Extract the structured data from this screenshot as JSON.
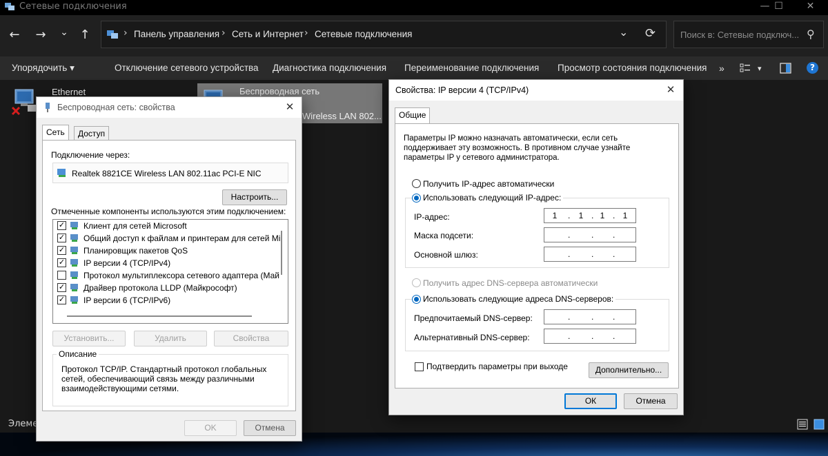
{
  "window": {
    "title": "Сетевые подключения",
    "controls": {
      "minimize": "—",
      "maximize": "☐",
      "close": "✕"
    }
  },
  "nav": {
    "back": "←",
    "forward": "→",
    "recent": "⌄",
    "up": "↑",
    "breadcrumb": [
      "Панель управления",
      "Сеть и Интернет",
      "Сетевые подключения"
    ],
    "separator": "›",
    "dropdown": "⌄",
    "refresh": "⟳",
    "search_placeholder": "Поиск в: Сетевые подключ...",
    "search_icon": "⚲"
  },
  "commands": {
    "organize": "Упорядочить",
    "items": [
      "Отключение сетевого устройства",
      "Диагностика подключения",
      "Переименование подключения",
      "Просмотр состояния подключения"
    ],
    "more": "»",
    "help": "?"
  },
  "connections": [
    {
      "name": "Ethernet",
      "status_icon": "red-x-icon"
    },
    {
      "name": "Беспроводная сеть",
      "device": "Wireless LAN 802..."
    }
  ],
  "status": {
    "items_label": "Элеме"
  },
  "wifi_props": {
    "title": "Беспроводная сеть: свойства",
    "close": "✕",
    "tabs": [
      "Сеть",
      "Доступ"
    ],
    "connect_via_label": "Подключение через:",
    "adapter": "Realtek 8821CE Wireless LAN 802.11ac PCI-E NIC",
    "configure": "Настроить...",
    "components_label": "Отмеченные компоненты используются этим подключением:",
    "components": [
      {
        "name": "Клиент для сетей Microsoft",
        "checked": true
      },
      {
        "name": "Общий доступ к файлам и принтерам для сетей Mi",
        "checked": true
      },
      {
        "name": "Планировщик пакетов QoS",
        "checked": true
      },
      {
        "name": "IP версии 4 (TCP/IPv4)",
        "checked": true
      },
      {
        "name": "Протокол мультиплексора сетевого адаптера (Май",
        "checked": false
      },
      {
        "name": "Драйвер протокола LLDP (Майкрософт)",
        "checked": true
      },
      {
        "name": "IP версии 6 (TCP/IPv6)",
        "checked": true
      }
    ],
    "check_mark": "✓",
    "install": "Установить...",
    "remove": "Удалить",
    "properties": "Свойства",
    "description_label": "Описание",
    "description": "Протокол TCP/IP. Стандартный протокол глобальных сетей, обеспечивающий связь между различными взаимодействующими сетями.",
    "ok": "OK",
    "cancel": "Отмена"
  },
  "ipv4_props": {
    "title": "Свойства: IP версии 4 (TCP/IPv4)",
    "close": "✕",
    "tab": "Общие",
    "intro": "Параметры IP можно назначать автоматически, если сеть поддерживает эту возможность. В противном случае узнайте параметры IP у сетевого администратора.",
    "auto_ip": "Получить IP-адрес автоматически",
    "manual_ip": "Использовать следующий IP-адрес:",
    "ip_label": "IP-адрес:",
    "ip_octets": [
      "1",
      "1",
      "1",
      "1"
    ],
    "mask_label": "Маска подсети:",
    "gateway_label": "Основной шлюз:",
    "auto_dns": "Получить адрес DNS-сервера автоматически",
    "manual_dns": "Использовать следующие адреса DNS-серверов:",
    "dns1_label": "Предпочитаемый DNS-сервер:",
    "dns2_label": "Альтернативный DNS-сервер:",
    "dot": ".",
    "validate": "Подтвердить параметры при выходе",
    "advanced": "Дополнительно...",
    "ok": "ОК",
    "cancel": "Отмена",
    "selected_ip_mode": "manual",
    "selected_dns_mode": "manual"
  },
  "colors": {
    "accent": "#0078d7",
    "radio": "#0067c0",
    "error": "#d61f1f"
  }
}
